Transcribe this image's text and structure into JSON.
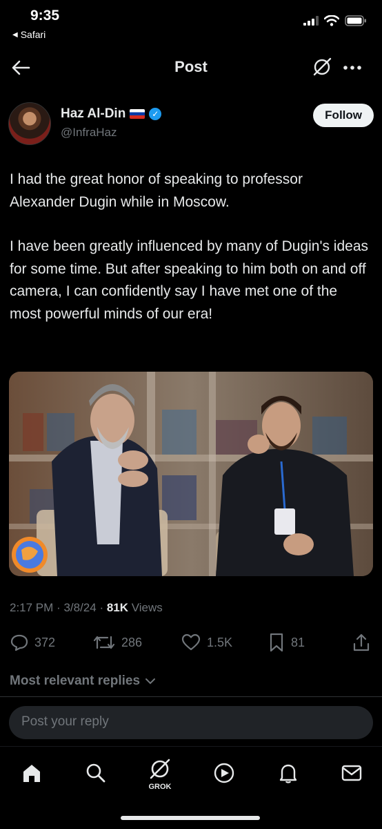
{
  "status_bar": {
    "time": "9:35",
    "back_app": "Safari"
  },
  "header": {
    "title": "Post"
  },
  "post": {
    "author_name": "Haz Al-Din",
    "handle": "@InfraHaz",
    "follow_label": "Follow",
    "paragraphs": [
      "I had the great honor of speaking to professor Alexander Dugin while in Moscow.",
      "I have been greatly influenced by many of Dugin's ideas for some time. But after speaking to him both on and off camera, I can confidently say I have met one of the most powerful minds of our era!"
    ],
    "time": "2:17 PM",
    "date": "3/8/24",
    "views_count": "81K",
    "views_label": "Views",
    "replies": "372",
    "reposts": "286",
    "likes": "1.5K",
    "bookmarks": "81"
  },
  "replies_sort": "Most relevant replies",
  "reply_placeholder": "Post your reply",
  "tabbar": {
    "grok_label": "GROK"
  },
  "colors": {
    "accent": "#1d9bf0",
    "background": "#000000",
    "muted": "#71767b"
  }
}
